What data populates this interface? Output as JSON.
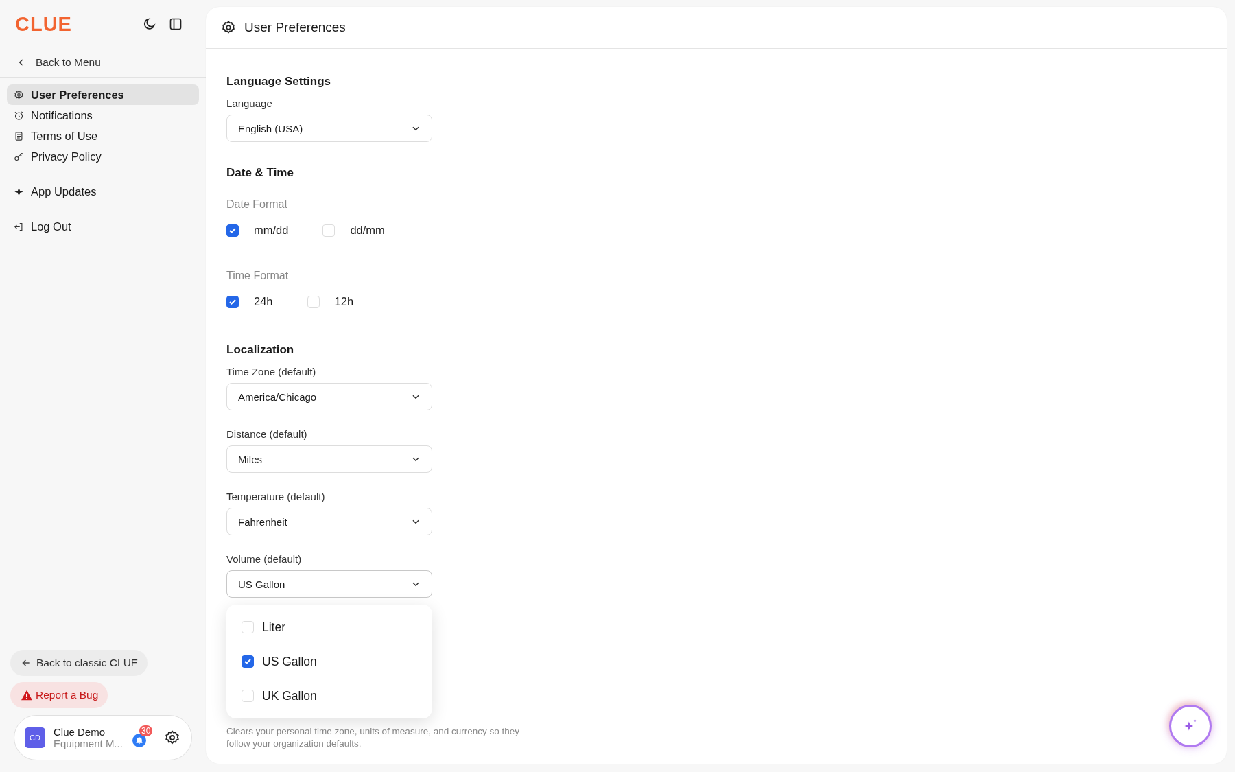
{
  "sidebar": {
    "logo": "CLUE",
    "back_link": "Back to Menu",
    "nav_groups": [
      [
        {
          "label": "User Preferences",
          "selected": true
        },
        {
          "label": "Notifications",
          "selected": false
        },
        {
          "label": "Terms of Use",
          "selected": false
        },
        {
          "label": "Privacy Policy",
          "selected": false
        }
      ],
      [
        {
          "label": "App Updates",
          "selected": false
        }
      ],
      [
        {
          "label": "Log Out",
          "selected": false
        }
      ]
    ],
    "classic_button": "Back to classic CLUE",
    "bug_button": "Report a Bug",
    "user": {
      "initials": "CD",
      "name": "Clue Demo",
      "subtitle": "Equipment M...",
      "badge": "30"
    }
  },
  "page": {
    "title": "User Preferences",
    "sections": [
      {
        "title": "Language Settings",
        "items": [
          {
            "kind": "select",
            "label": "Language",
            "value": "English (USA)",
            "expanded": false
          }
        ]
      },
      {
        "title": "Date & Time",
        "items": [
          {
            "kind": "checks",
            "label": "Date Format",
            "options": [
              {
                "label": "mm/dd",
                "checked": true
              },
              {
                "label": "dd/mm",
                "checked": false
              }
            ]
          },
          {
            "kind": "checks",
            "label": "Time Format",
            "options": [
              {
                "label": "24h",
                "checked": true
              },
              {
                "label": "12h",
                "checked": false
              }
            ]
          }
        ]
      },
      {
        "title": "Localization",
        "items": [
          {
            "kind": "select",
            "label": "Time Zone (default)",
            "value": "America/Chicago",
            "expanded": false
          },
          {
            "kind": "select",
            "label": "Distance (default)",
            "value": "Miles",
            "expanded": false
          },
          {
            "kind": "select",
            "label": "Temperature (default)",
            "value": "Fahrenheit",
            "expanded": false
          },
          {
            "kind": "select",
            "label": "Volume (default)",
            "value": "US Gallon",
            "expanded": true,
            "options": [
              {
                "label": "Liter",
                "checked": false
              },
              {
                "label": "US Gallon",
                "checked": true
              },
              {
                "label": "UK Gallon",
                "checked": false
              }
            ]
          },
          {
            "kind": "note",
            "text": "Clears your personal time zone, units of measure, and currency so they follow your organization defaults."
          }
        ]
      }
    ]
  }
}
